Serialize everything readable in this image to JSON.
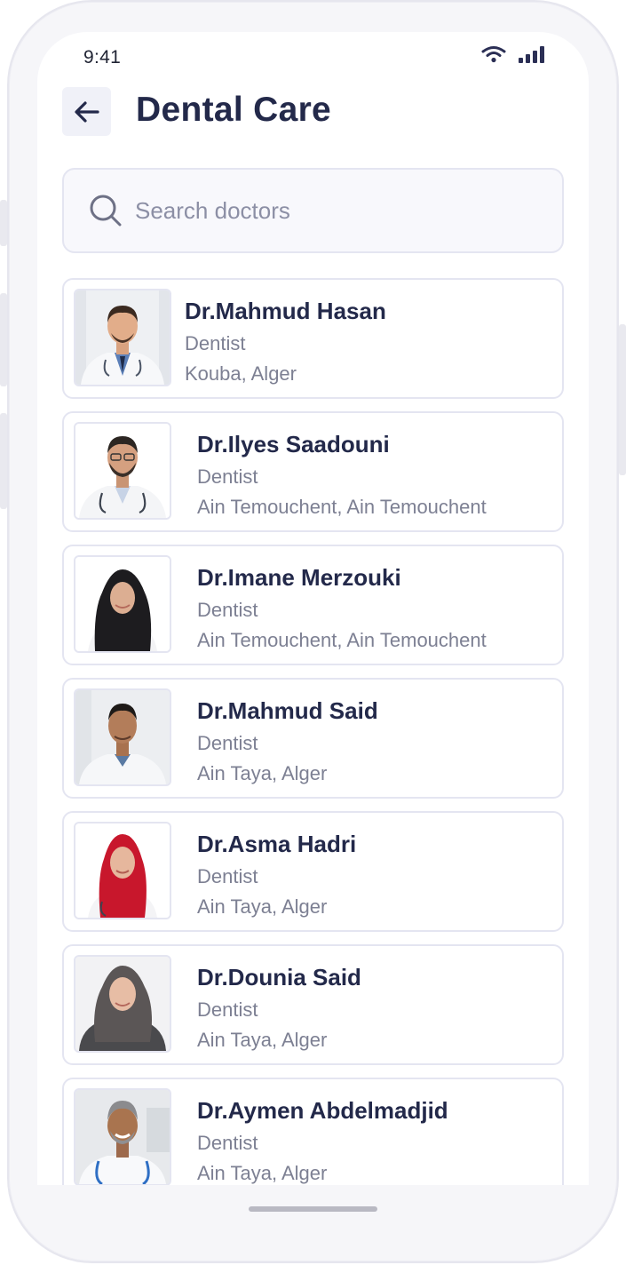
{
  "status_bar": {
    "time": "9:41"
  },
  "header": {
    "title": "Dental Care"
  },
  "search": {
    "placeholder": "Search doctors"
  },
  "doctors": [
    {
      "name": "Dr.Mahmud Hasan",
      "specialty": "Dentist",
      "location": "Kouba, Alger"
    },
    {
      "name": "Dr.Ilyes Saadouni",
      "specialty": "Dentist",
      "location": "Ain Temouchent, Ain Temouchent"
    },
    {
      "name": "Dr.Imane Merzouki",
      "specialty": "Dentist",
      "location": "Ain Temouchent, Ain Temouchent"
    },
    {
      "name": "Dr.Mahmud Said",
      "specialty": "Dentist",
      "location": "Ain Taya, Alger"
    },
    {
      "name": "Dr.Asma Hadri",
      "specialty": "Dentist",
      "location": "Ain Taya, Alger"
    },
    {
      "name": "Dr.Dounia Said",
      "specialty": "Dentist",
      "location": "Ain Taya, Alger"
    },
    {
      "name": "Dr.Aymen Abdelmadjid",
      "specialty": "Dentist",
      "location": "Ain Taya, Alger"
    }
  ],
  "icons": {
    "back": "arrow-left-icon",
    "search": "search-icon",
    "wifi": "wifi-icon",
    "signal": "cellular-signal-icon"
  },
  "colors": {
    "title": "#23294a",
    "muted_text": "#7d8093",
    "border": "#e4e5f1",
    "back_button_bg": "#f0f1f8"
  }
}
